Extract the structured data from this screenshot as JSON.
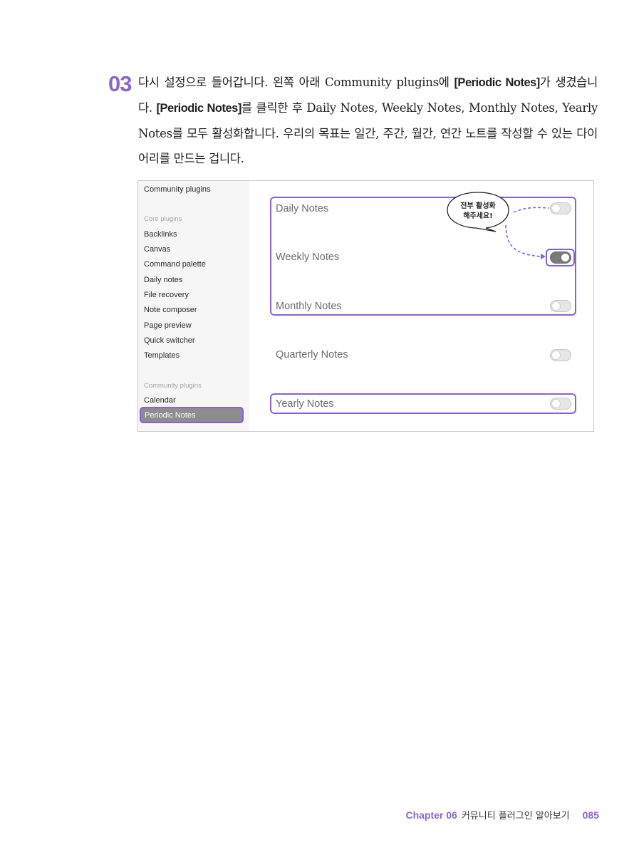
{
  "step": {
    "number": "03"
  },
  "body_text": {
    "p1": "다시 설정으로 들어갑니다. 왼쪽 아래 Community plugins에 ",
    "h1": "[Periodic Notes]",
    "p2": "가 생겼습니다. ",
    "h2": "[Periodic Notes]",
    "p3": "를 클릭한 후 Daily Notes, Weekly Notes, Monthly Notes, Yearly Notes를 모두 활성화합니다. 우리의 목표는 일간, 주간, 월간, 연간 노트를 작성할 수 있는 다이어리를 만드는 겁니다."
  },
  "screenshot": {
    "sidebar": {
      "top_item": "Community plugins",
      "core_header": "Core plugins",
      "core_items": [
        "Backlinks",
        "Canvas",
        "Command palette",
        "Daily notes",
        "File recovery",
        "Note composer",
        "Page preview",
        "Quick switcher",
        "Templates"
      ],
      "community_header": "Community plugins",
      "community_items": [
        "Calendar"
      ],
      "selected_item": "Periodic Notes"
    },
    "settings": [
      {
        "label": "Daily Notes",
        "enabled": false
      },
      {
        "label": "Weekly Notes",
        "enabled": true
      },
      {
        "label": "Monthly Notes",
        "enabled": false
      },
      {
        "label": "Quarterly Notes",
        "enabled": false
      },
      {
        "label": "Yearly Notes",
        "enabled": false
      }
    ],
    "callout": {
      "line1": "전부 활성화",
      "line2": "해주세요!"
    },
    "accent_color": "#8a62cc"
  },
  "footer": {
    "chapter": "Chapter 06",
    "title": "커뮤니티 플러그인 알아보기",
    "page": "085"
  }
}
